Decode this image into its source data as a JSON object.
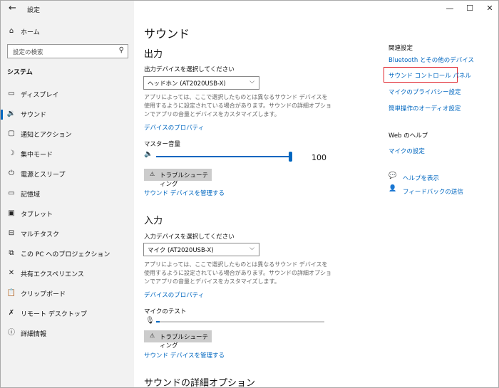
{
  "window": {
    "title": "設定",
    "back_glyph": "←",
    "min_glyph": "—",
    "max_glyph": "☐",
    "close_glyph": "✕"
  },
  "sidebar": {
    "home": "ホーム",
    "search_placeholder": "設定の検索",
    "section": "システム",
    "items": [
      {
        "label": "ディスプレイ",
        "icon": "display-icon",
        "glyph": "▭"
      },
      {
        "label": "サウンド",
        "icon": "speaker-icon",
        "glyph": "🔉",
        "active": true
      },
      {
        "label": "通知とアクション",
        "icon": "notification-icon",
        "glyph": "▢"
      },
      {
        "label": "集中モード",
        "icon": "moon-icon",
        "glyph": "☽"
      },
      {
        "label": "電源とスリープ",
        "icon": "power-icon",
        "glyph": "⏻"
      },
      {
        "label": "記憶域",
        "icon": "storage-icon",
        "glyph": "▭"
      },
      {
        "label": "タブレット",
        "icon": "tablet-icon",
        "glyph": "▣"
      },
      {
        "label": "マルチタスク",
        "icon": "multitask-icon",
        "glyph": "⊟"
      },
      {
        "label": "この PC へのプロジェクション",
        "icon": "projection-icon",
        "glyph": "⧉"
      },
      {
        "label": "共有エクスペリエンス",
        "icon": "shared-icon",
        "glyph": "✕"
      },
      {
        "label": "クリップボード",
        "icon": "clipboard-icon",
        "glyph": "📋"
      },
      {
        "label": "リモート デスクトップ",
        "icon": "remote-icon",
        "glyph": "✗"
      },
      {
        "label": "詳細情報",
        "icon": "info-icon",
        "glyph": "ⓘ"
      }
    ]
  },
  "main": {
    "page_title": "サウンド",
    "output": {
      "heading": "出力",
      "device_label": "出力デバイスを選択してください",
      "device_value": "ヘッドホン (AT2020USB-X)",
      "description": "アプリによっては、ここで選択したものとは異なるサウンド デバイスを使用するように設定されている場合があります。サウンドの詳細オプションでアプリの音量とデバイスをカスタマイズします。",
      "properties_link": "デバイスのプロパティ",
      "volume_label": "マスター音量",
      "volume_value": "100",
      "volume_level": 1.0,
      "troubleshoot": "トラブルシューティング",
      "manage_link": "サウンド デバイスを管理する"
    },
    "input": {
      "heading": "入力",
      "device_label": "入力デバイスを選択してください",
      "device_value": "マイク (AT2020USB-X)",
      "description": "アプリによっては、ここで選択したものとは異なるサウンド デバイスを使用するように設定されている場合があります。サウンドの詳細オプションでアプリの音量とデバイスをカスタマイズします。",
      "properties_link": "デバイスのプロパティ",
      "mic_test_label": "マイクのテスト",
      "mic_level": 0.02,
      "troubleshoot": "トラブルシューティング",
      "manage_link": "サウンド デバイスを管理する"
    },
    "advanced_heading": "サウンドの詳細オプション"
  },
  "related": {
    "title": "関連設定",
    "links": [
      "Bluetooth とその他のデバイス",
      "サウンド コントロール パネル",
      "マイクのプライバシー設定",
      "簡単操作のオーディオ設定"
    ],
    "highlight_color": "#e0262e"
  },
  "web_help": {
    "title": "Web のヘルプ",
    "link": "マイクの設定"
  },
  "help": {
    "get_help": "ヘルプを表示",
    "feedback": "フィードバックの送信"
  },
  "colors": {
    "accent": "#0067c0",
    "sidebar_bg": "#f2f2f2"
  }
}
